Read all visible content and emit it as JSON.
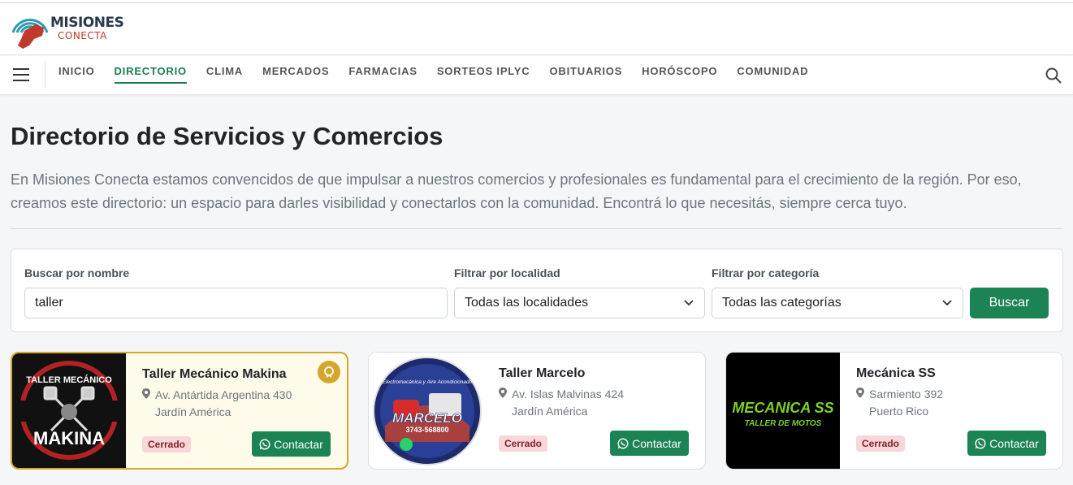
{
  "brand": {
    "line1": "MISIONES",
    "line2": "CONECTA"
  },
  "nav": {
    "items": [
      "INICIO",
      "DIRECTORIO",
      "CLIMA",
      "MERCADOS",
      "FARMACIAS",
      "SORTEOS IPLYC",
      "OBITUARIOS",
      "HORÓSCOPO",
      "COMUNIDAD"
    ],
    "active": "DIRECTORIO"
  },
  "page": {
    "title": "Directorio de Servicios y Comercios",
    "intro": "En Misiones Conecta estamos convencidos de que impulsar a nuestros comercios y profesionales es fundamental para el crecimiento de la región. Por eso, creamos este directorio: un espacio para darles visibilidad y conectarlos con la comunidad. Encontrá lo que necesitás, siempre cerca tuyo."
  },
  "filters": {
    "name_label": "Buscar por nombre",
    "name_value": "taller",
    "locality_label": "Filtrar por localidad",
    "locality_value": "Todas las localidades",
    "category_label": "Filtrar por categoría",
    "category_value": "Todas las categorías",
    "submit": "Buscar"
  },
  "cards": [
    {
      "name": "Taller Mecánico Makina",
      "address": "Av. Antártida Argentina 430",
      "city": "Jardín América",
      "status": "Cerrado",
      "contact": "Contactar",
      "featured": true,
      "logo_text": {
        "top": "TALLER MECÁNICO",
        "bottom": "MAKINA"
      }
    },
    {
      "name": "Taller Marcelo",
      "address": "Av. Islas Malvinas 424",
      "city": "Jardín América",
      "status": "Cerrado",
      "contact": "Contactar",
      "featured": false,
      "logo_text": {
        "top": "Electromecánica y Aire Acondicionado",
        "bottom": "MARCELO",
        "phone": "3743-568800"
      }
    },
    {
      "name": "Mecánica SS",
      "address": "Sarmiento 392",
      "city": "Puerto Rico",
      "status": "Cerrado",
      "contact": "Contactar",
      "featured": false,
      "logo_text": {
        "top": "MECANICA SS",
        "bottom": "TALLER DE MOTOS"
      }
    }
  ],
  "colors": {
    "accent": "#1b8354",
    "featured_border": "#d4a72c",
    "closed_bg": "#f8d7da",
    "closed_text": "#842029"
  }
}
